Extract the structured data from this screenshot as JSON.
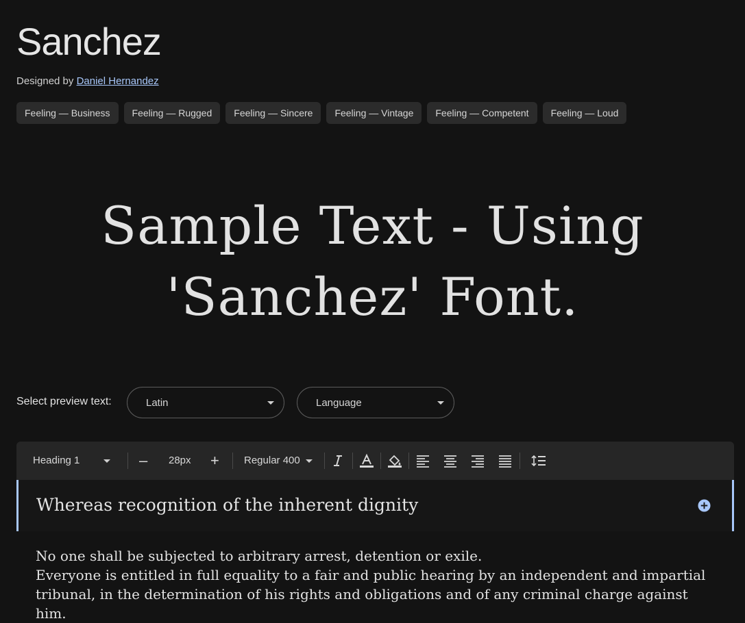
{
  "font": {
    "name": "Sanchez",
    "designed_by_label": "Designed by",
    "designer": "Daniel Hernandez"
  },
  "tags": [
    "Feeling — Business",
    "Feeling — Rugged",
    "Feeling — Sincere",
    "Feeling — Vintage",
    "Feeling — Competent",
    "Feeling — Loud"
  ],
  "hero": {
    "line1": "Sample Text - Using",
    "line2": "'Sanchez' Font."
  },
  "preview": {
    "label": "Select preview text:",
    "script_value": "Latin",
    "language_value": "Language"
  },
  "toolbar": {
    "style_value": "Heading 1",
    "size_value": "28px",
    "weight_value": "Regular 400",
    "decrease_label": "–",
    "increase_label": "+"
  },
  "editor": {
    "heading_text": "Whereas recognition of the inherent dignity",
    "body_line1": "No one shall be subjected to arbitrary arrest, detention or exile.",
    "body_line2": "Everyone is entitled in full equality to a fair and public hearing by an independent and impartial tribunal, in the determination of his rights and obligations and of any criminal charge against him."
  },
  "colors": {
    "background": "#131313",
    "accent": "#a8c7fa",
    "tag_bg": "#2b2b2b",
    "toolbar_bg": "#262626"
  }
}
